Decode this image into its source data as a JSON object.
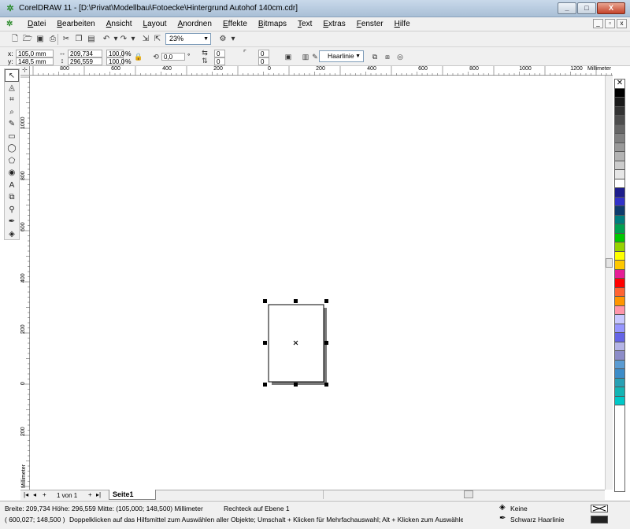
{
  "window": {
    "title": "CorelDRAW 11 - [D:\\Privat\\Modellbau\\Fotoecke\\Hintergrund Autohof 140cm.cdr]",
    "app_icon": "coreldraw-balloon-icon",
    "buttons": [
      "_",
      "□",
      "X"
    ]
  },
  "menu": {
    "items": [
      "Datei",
      "Bearbeiten",
      "Ansicht",
      "Layout",
      "Anordnen",
      "Effekte",
      "Bitmaps",
      "Text",
      "Extras",
      "Fenster",
      "Hilfe"
    ],
    "mdi_buttons": [
      "_",
      "▫",
      "x"
    ]
  },
  "standard_toolbar": {
    "zoom_value": "23%",
    "icons": [
      "new-icon",
      "open-icon",
      "save-icon",
      "print-icon",
      "cut-icon",
      "copy-icon",
      "paste-icon",
      "undo-icon",
      "redo-icon",
      "import-icon",
      "export-icon",
      "application-launcher-icon"
    ]
  },
  "property_bar": {
    "x_label": "x:",
    "x_value": "105,0 mm",
    "y_label": "y:",
    "y_value": "148,5 mm",
    "width_value": "209,734 mr",
    "height_value": "296,559 mr",
    "scale_x": "100,0",
    "scale_y": "100,0",
    "pct": "%",
    "rotation_value": "0,0",
    "degree": "°",
    "corner_values": [
      "0",
      "0",
      "0",
      "0"
    ],
    "outline_width": "Haarlinie"
  },
  "rulers": {
    "units": "Millimeter",
    "h_labels": [
      "800",
      "600",
      "400",
      "200",
      "0",
      "200",
      "400",
      "600",
      "800",
      "1000",
      "1200"
    ],
    "v_labels": [
      "1000",
      "800",
      "600",
      "400",
      "200",
      "0",
      "200"
    ]
  },
  "palette": {
    "colors": [
      "#000000",
      "#1a1a1a",
      "#333333",
      "#4d4d4d",
      "#666666",
      "#808080",
      "#999999",
      "#b3b3b3",
      "#cccccc",
      "#e6e6e6",
      "#ffffff",
      "#1e1e8c",
      "#3232c8",
      "#0f3c6e",
      "#007d7d",
      "#00a050",
      "#00c800",
      "#96d200",
      "#ffff00",
      "#ffc800",
      "#e61e96",
      "#ff0000",
      "#ff6432",
      "#ff9600",
      "#ff96aa",
      "#c8c8ff",
      "#9696ff",
      "#6464e6",
      "#b4b4e6",
      "#8c8cc8",
      "#5a9bd2",
      "#3c8cc8",
      "#28a0b4",
      "#14b4b4",
      "#00c8c8"
    ]
  },
  "page_tabs": {
    "page_count": "1 von 1",
    "tab_label": "Seite1"
  },
  "status": {
    "dimensions": "Breite: 209,734  Höhe: 296,559  Mitte: (105,000; 148,500)  Millimeter",
    "object_info": "Rechteck auf Ebene 1",
    "cursor": "( 600,027; 148,500 )",
    "hint": "Doppelklicken auf das Hilfsmittel zum Auswählen aller Objekte; Umschalt + Klicken für Mehrfachauswahl; Alt + Klicken zum Auswählen überdeckter O...",
    "fill_label": "Keine",
    "outline_label": "Schwarz  Haarlinie",
    "fill_color": "#ffffff",
    "outline_color": "#222222"
  }
}
